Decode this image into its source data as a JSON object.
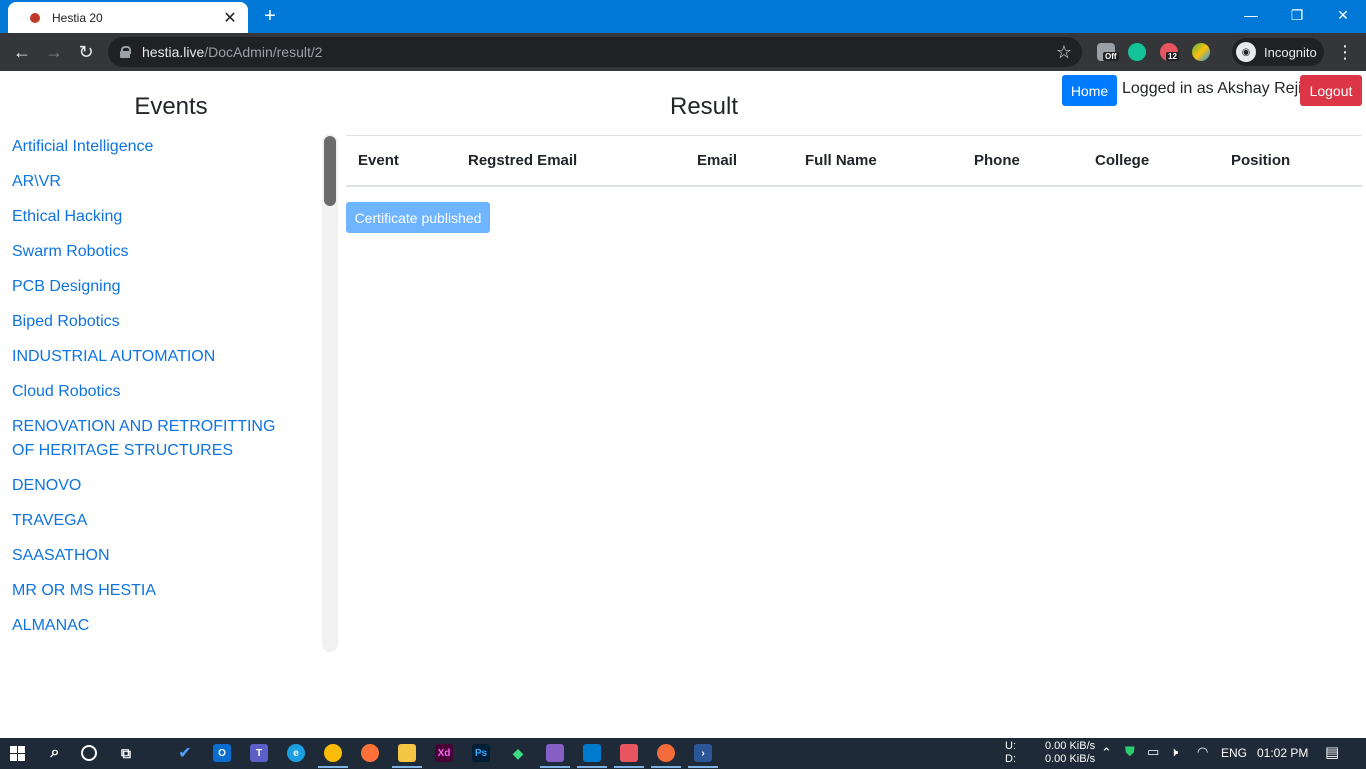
{
  "browser": {
    "tab_title": "Hestia 20",
    "tab_close": "✕",
    "new_tab": "+",
    "url_host": "hestia.live",
    "url_path": "/DocAdmin/result/2",
    "incognito_label": "Incognito",
    "extension_badges": {
      "off": "Off",
      "count": "12"
    },
    "window_controls": [
      "—",
      "❐",
      "✕"
    ]
  },
  "header": {
    "home_label": "Home",
    "logged_in_text": "Logged in as Akshay Reji",
    "logout_label": "Logout"
  },
  "sidebar": {
    "title": "Events",
    "items": [
      "Artificial Intelligence",
      "AR\\VR",
      "Ethical Hacking",
      "Swarm Robotics",
      "PCB Designing",
      "Biped Robotics",
      "INDUSTRIAL AUTOMATION",
      "Cloud Robotics",
      "RENOVATION AND RETROFITTING OF HERITAGE STRUCTURES",
      "DENOVO",
      "TRAVEGA",
      "SAASATHON",
      "MR OR MS HESTIA",
      "ALMANAC"
    ]
  },
  "main": {
    "title": "Result",
    "columns": [
      "Event",
      "Regstred Email",
      "Email",
      "Full Name",
      "Phone",
      "College",
      "Position"
    ],
    "certificate_button": "Certificate published"
  },
  "taskbar": {
    "net_up_label": "U:",
    "net_down_label": "D:",
    "net_up": "0.00 KiB/s",
    "net_down": "0.00 KiB/s",
    "language": "ENG",
    "time": "01:02 PM"
  },
  "colors": {
    "titlebar": "#0078d7",
    "link": "#0f74e0",
    "home_button": "#007bff",
    "logout_button": "#dc3545",
    "certificate_button": "#6fb4ff"
  }
}
